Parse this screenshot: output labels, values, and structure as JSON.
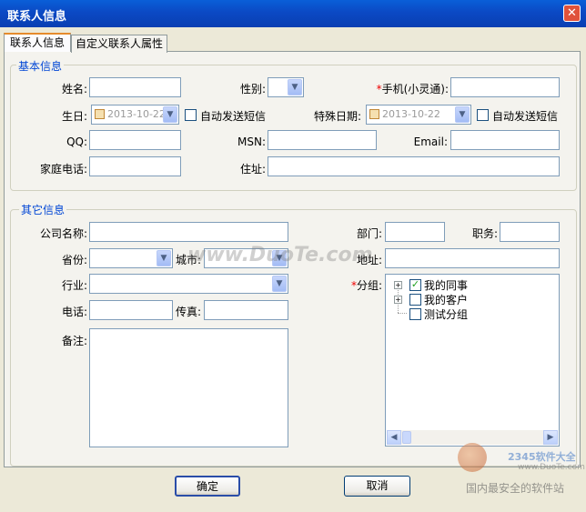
{
  "window": {
    "title": "联系人信息",
    "close_glyph": "✕"
  },
  "tabs": [
    {
      "label": "联系人信息",
      "active": true
    },
    {
      "label": "自定义联系人属性",
      "active": false
    }
  ],
  "basic": {
    "legend": "基本信息",
    "name_label": "姓名:",
    "gender_label": "性别:",
    "mobile_label": "手机(小灵通):",
    "required_mark": "*",
    "birthday_label": "生日:",
    "birthday_value": "2013-10-22",
    "auto_sms_label": "自动发送短信",
    "special_date_label": "特殊日期:",
    "special_date_value": "2013-10-22",
    "auto_sms_label2": "自动发送短信",
    "qq_label": "QQ:",
    "msn_label": "MSN:",
    "email_label": "Email:",
    "home_phone_label": "家庭电话:",
    "address_label": "住址:"
  },
  "other": {
    "legend": "其它信息",
    "company_label": "公司名称:",
    "department_label": "部门:",
    "position_label": "职务:",
    "province_label": "省份:",
    "city_label": "城市:",
    "address_label": "地址:",
    "industry_label": "行业:",
    "group_label": "分组:",
    "phone_label": "电话:",
    "fax_label": "传真:",
    "notes_label": "备注:",
    "groups": [
      {
        "label": "我的同事",
        "checked": true,
        "expandable": true
      },
      {
        "label": "我的客户",
        "checked": false,
        "expandable": true
      },
      {
        "label": "测试分组",
        "checked": false,
        "expandable": false
      }
    ]
  },
  "buttons": {
    "ok": "确定",
    "cancel": "取消"
  },
  "watermark": {
    "center": "www.DuoTe.com",
    "brand": "2345软件大全",
    "url": "www.DuoTe.com",
    "slogan": "国内最安全的软件站"
  },
  "icons": {
    "dropdown": "chevron-down-icon",
    "calendar": "calendar-icon",
    "scroll_left": "scroll-left-icon",
    "scroll_right": "scroll-right-icon"
  }
}
